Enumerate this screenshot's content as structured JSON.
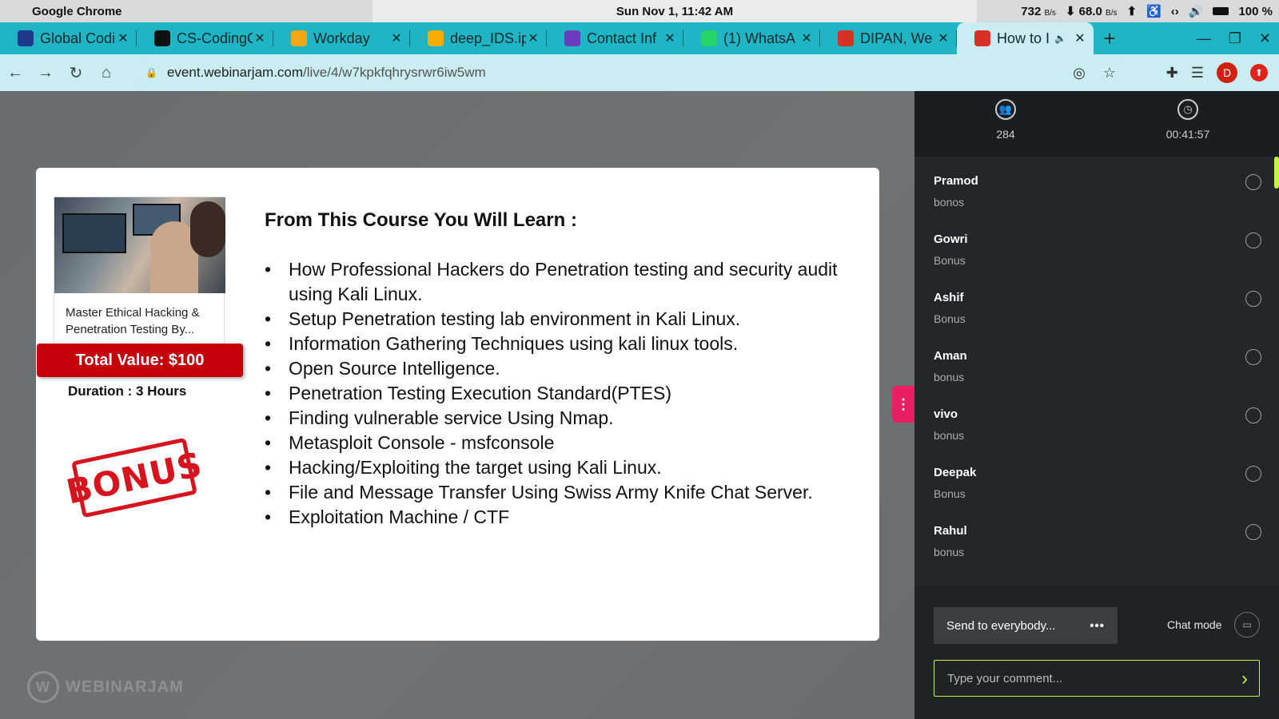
{
  "menubar": {
    "app_name": "Google Chrome",
    "clock": "Sun Nov  1, 11:42 AM",
    "net_up": "732",
    "net_up_unit": "B/s",
    "net_down": "68.0",
    "net_down_unit": "B/s",
    "battery": "100 %"
  },
  "tabs": [
    {
      "title": "Global Codi",
      "icon": "wing-icon",
      "color": "#1f3a8a"
    },
    {
      "title": "CS-CodingC",
      "icon": "github-icon",
      "color": "#111111"
    },
    {
      "title": "Workday",
      "icon": "workday-icon",
      "color": "#f3a712"
    },
    {
      "title": "deep_IDS.ip",
      "icon": "colab-icon",
      "color": "#f9ab00"
    },
    {
      "title": "Contact Inf",
      "icon": "forms-icon",
      "color": "#6a3bbd"
    },
    {
      "title": "(1) WhatsA",
      "icon": "whatsapp-icon",
      "color": "#25d366"
    },
    {
      "title": "DIPAN, We",
      "icon": "gmail-icon",
      "color": "#d93025"
    },
    {
      "title": "How to I",
      "icon": "webinarjam-icon",
      "color": "#d93025"
    }
  ],
  "url": {
    "domain": "event.webinarjam.com",
    "path": "/live/4/w7kpkfqhrysrwr6iw5wm"
  },
  "profile_initial": "D",
  "slide": {
    "course_name": "Master Ethical Hacking & Penetration Testing By...",
    "total_value": "Total Value: $100",
    "duration": "Duration : 3 Hours",
    "bonus": "BONUS",
    "learn_title": "From This Course You Will Learn :",
    "learn_items": [
      "How Professional Hackers do Penetration testing and security audit using Kali Linux.",
      "Setup Penetration testing lab environment in Kali Linux.",
      "Information Gathering Techniques using kali linux tools.",
      "Open Source Intelligence.",
      "Penetration Testing Execution Standard(PTES)",
      "Finding vulnerable service Using Nmap.",
      "Metasploit Console - msfconsole",
      "Hacking/Exploiting the target using Kali Linux.",
      "File and Message Transfer Using Swiss Army Knife Chat Server.",
      "Exploitation Machine / CTF"
    ]
  },
  "watermark": "WEBINARJAM",
  "chat": {
    "attendees": "284",
    "elapsed": "00:41:57",
    "messages": [
      {
        "author": "Pramod",
        "text": "bonos"
      },
      {
        "author": "Gowri",
        "text": "Bonus"
      },
      {
        "author": "Ashif",
        "text": "Bonus"
      },
      {
        "author": "Aman",
        "text": "bonus"
      },
      {
        "author": "vivo",
        "text": "bonus"
      },
      {
        "author": "Deepak",
        "text": "Bonus"
      },
      {
        "author": "Rahul",
        "text": "bonus"
      }
    ],
    "send_to": "Send to everybody...",
    "chat_mode": "Chat mode",
    "comment_placeholder": "Type your comment...",
    "accent": "#c3f73a"
  }
}
